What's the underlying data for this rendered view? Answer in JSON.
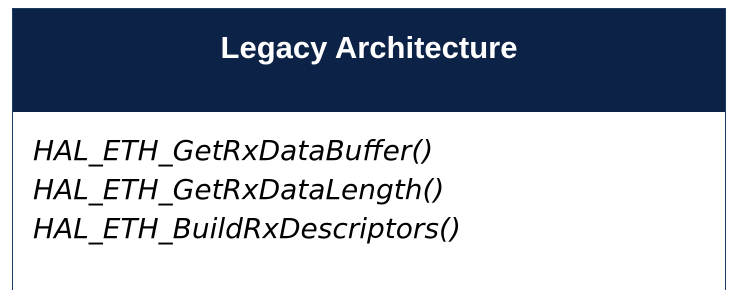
{
  "box": {
    "title": "Legacy Architecture",
    "functions": [
      "HAL_ETH_GetRxDataBuffer()",
      "HAL_ETH_GetRxDataLength()",
      "HAL_ETH_BuildRxDescriptors()"
    ]
  },
  "colors": {
    "header_bg": "#0c2246",
    "header_text": "#ffffff",
    "body_text": "#000000",
    "border": "#1b3a63"
  }
}
